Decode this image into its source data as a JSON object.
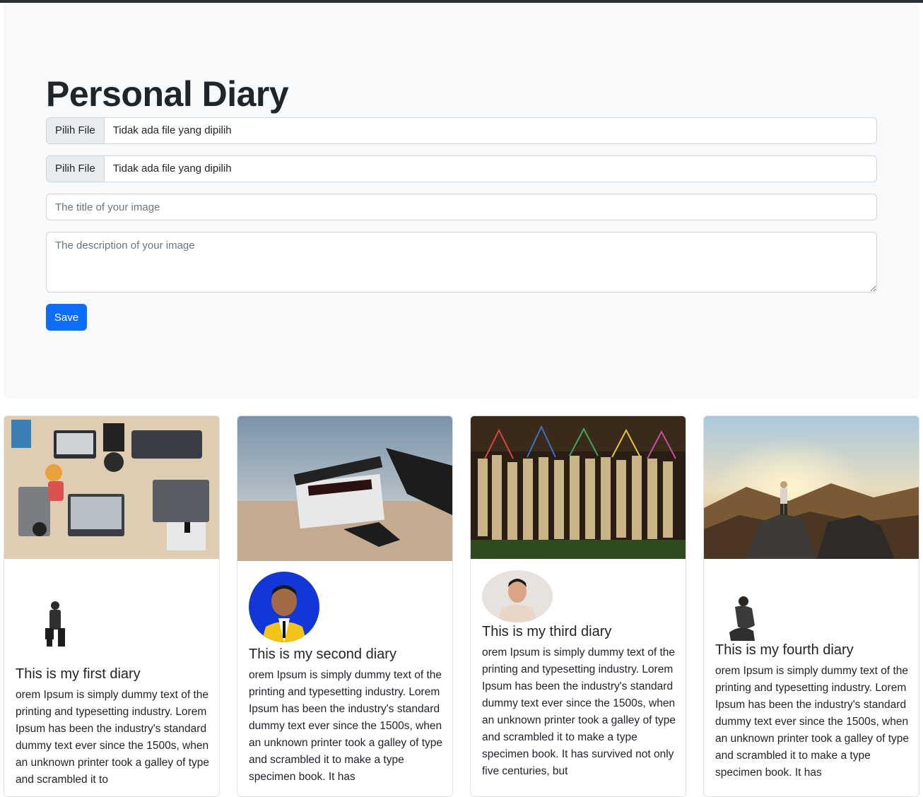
{
  "page": {
    "title": "Personal Diary"
  },
  "form": {
    "file_inputs": [
      {
        "button_label": "Pilih File",
        "status_text": "Tidak ada file yang dipilih"
      },
      {
        "button_label": "Pilih File",
        "status_text": "Tidak ada file yang dipilih"
      }
    ],
    "title_input": {
      "value": "",
      "placeholder": "The title of your image"
    },
    "description_input": {
      "value": "",
      "placeholder": "The description of your image"
    },
    "save_label": "Save"
  },
  "cards": [
    {
      "image": "office-desk-laptops-photo",
      "avatar": "standing-man-photo",
      "title": "This is my first diary",
      "text": "orem Ipsum is simply dummy text of the printing and typesetting industry. Lorem Ipsum has been the industry's standard dummy text ever since the 1500s, when an unknown printer took a galley of type and scrambled it to"
    },
    {
      "image": "film-clapperboard-photo",
      "avatar": "graduate-portrait-photo",
      "title": "This is my second diary",
      "text": "orem Ipsum is simply dummy text of the printing and typesetting industry. Lorem Ipsum has been the industry's standard dummy text ever since the 1500s, when an unknown printer took a galley of type and scrambled it to make a type specimen book. It has"
    },
    {
      "image": "bamboo-fortune-sticks-photo",
      "avatar": "young-man-portrait-photo",
      "title": "This is my third diary",
      "text": "orem Ipsum is simply dummy text of the printing and typesetting industry. Lorem Ipsum has been the industry's standard dummy text ever since the 1500s, when an unknown printer took a galley of type and scrambled it to make a type specimen book. It has survived not only five centuries, but"
    },
    {
      "image": "mountain-sunrise-photo",
      "avatar": "sitting-man-photo",
      "title": "This is my fourth diary",
      "text": "orem Ipsum is simply dummy text of the printing and typesetting industry. Lorem Ipsum has been the industry's standard dummy text ever since the 1500s, when an unknown printer took a galley of type and scrambled it to make a type specimen book. It has"
    }
  ],
  "colors": {
    "primary": "#0d6efd",
    "jumbotron_bg": "#f8f9fa",
    "border": "#ced4da"
  }
}
